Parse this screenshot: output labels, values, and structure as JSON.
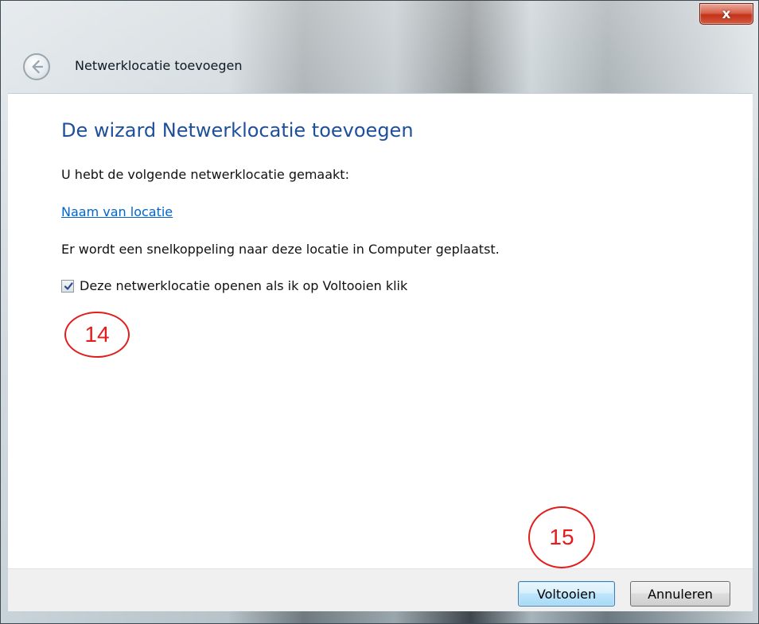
{
  "window": {
    "title": "Netwerklocatie toevoegen",
    "close_glyph": "x",
    "icons": [
      "back-arrow-icon",
      "close-icon"
    ]
  },
  "main": {
    "heading": "De wizard Netwerklocatie toevoegen",
    "created_text": "U hebt de volgende netwerklocatie gemaakt:",
    "location_link": "Naam van locatie",
    "shortcut_text": "Er wordt een snelkoppeling naar deze locatie in Computer geplaatst.",
    "open_checkbox": {
      "label": "Deze netwerklocatie openen als ik op Voltooien klik",
      "checked": true
    }
  },
  "annotations": {
    "a14": "14",
    "a15": "15",
    "color": "#e11d1d"
  },
  "footer": {
    "finish_label": "Voltooien",
    "cancel_label": "Annuleren"
  },
  "colors": {
    "heading": "#1e4f9b",
    "link": "#0066cc"
  }
}
